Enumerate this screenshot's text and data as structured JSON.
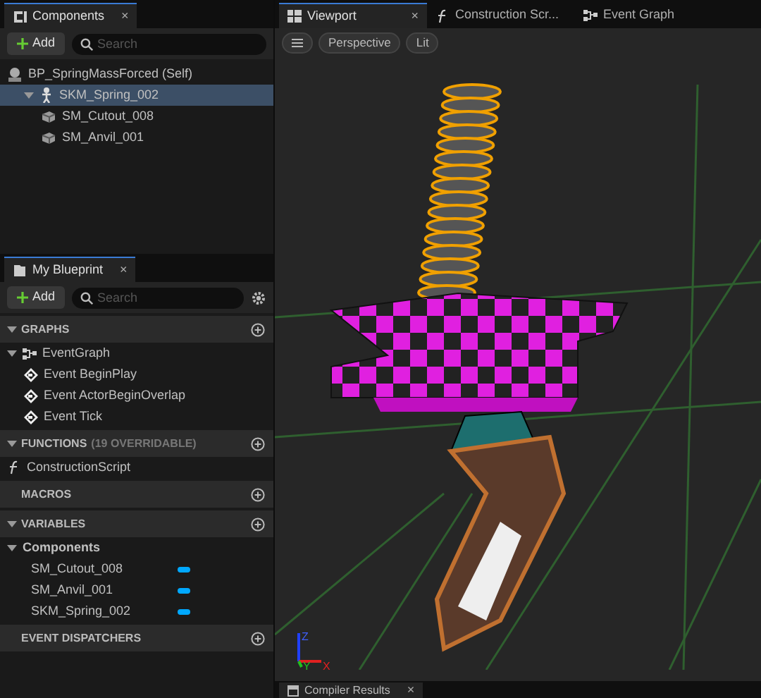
{
  "components_panel": {
    "title": "Components",
    "close_label": "×",
    "add_button": "Add",
    "search": {
      "placeholder": "Search"
    },
    "tree": [
      {
        "label": "BP_SpringMassForced (Self)",
        "kind": "actor",
        "selected": false,
        "children": [
          {
            "label": "SKM_Spring_002",
            "kind": "skeletal",
            "selected": true,
            "expanded": true,
            "children": [
              {
                "label": "SM_Cutout_008",
                "kind": "mesh",
                "selected": false
              },
              {
                "label": "SM_Anvil_001",
                "kind": "mesh",
                "selected": false
              }
            ]
          }
        ]
      }
    ]
  },
  "my_blueprint": {
    "title": "My Blueprint",
    "close_label": "×",
    "add_button": "Add",
    "search": {
      "placeholder": "Search"
    },
    "sections": [
      {
        "title": "GRAPHS",
        "expanded": true,
        "items": [
          {
            "label": "EventGraph",
            "kind": "graph",
            "expanded": true,
            "children": [
              {
                "label": "Event BeginPlay",
                "kind": "event"
              },
              {
                "label": "Event ActorBeginOverlap",
                "kind": "event"
              },
              {
                "label": "Event Tick",
                "kind": "event"
              }
            ]
          }
        ]
      },
      {
        "title": "FUNCTIONS",
        "subtitle": "(19 OVERRIDABLE)",
        "expanded": true,
        "items": [
          {
            "label": "ConstructionScript",
            "kind": "function"
          }
        ]
      },
      {
        "title": "MACROS",
        "expanded": false
      },
      {
        "title": "VARIABLES",
        "expanded": true,
        "items": [
          {
            "label": "Components",
            "kind": "category",
            "expanded": true,
            "children": [
              {
                "label": "SM_Cutout_008",
                "kind": "variable"
              },
              {
                "label": "SM_Anvil_001",
                "kind": "variable"
              },
              {
                "label": "SKM_Spring_002",
                "kind": "variable"
              }
            ]
          }
        ]
      },
      {
        "title": "EVENT DISPATCHERS",
        "expanded": false
      }
    ]
  },
  "editor_tabs": [
    {
      "label": "Viewport",
      "kind": "viewport",
      "selected": true,
      "close_label": "×"
    },
    {
      "label": "Construction Scr...",
      "kind": "function",
      "selected": false
    },
    {
      "label": "Event Graph",
      "kind": "graph",
      "selected": false
    }
  ],
  "viewport": {
    "buttons": [
      "Perspective",
      "Lit"
    ],
    "axis_labels": [
      "Z",
      "Y",
      "X"
    ]
  },
  "bottom_tab": {
    "label": "Compiler Results",
    "close_label": "×"
  }
}
